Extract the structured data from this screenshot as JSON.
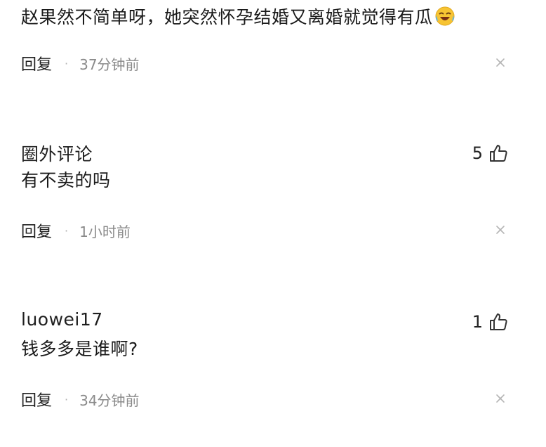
{
  "comments": [
    {
      "author": "",
      "text": "赵果然不简单呀，她突然怀孕结婚又离婚就觉得有瓜",
      "reply_label": "回复",
      "time": "37分钟前",
      "likes": "",
      "emoji": "laughing-tears-emoji"
    },
    {
      "author": "圈外评论",
      "text": "有不卖的吗",
      "reply_label": "回复",
      "time": "1小时前",
      "likes": "5"
    },
    {
      "author": "luowei17",
      "text": "钱多多是谁啊?",
      "reply_label": "回复",
      "time": "34分钟前",
      "likes": "1"
    }
  ],
  "separator": "·",
  "icons": {
    "like": "thumbs-up-icon",
    "close": "close-icon"
  }
}
